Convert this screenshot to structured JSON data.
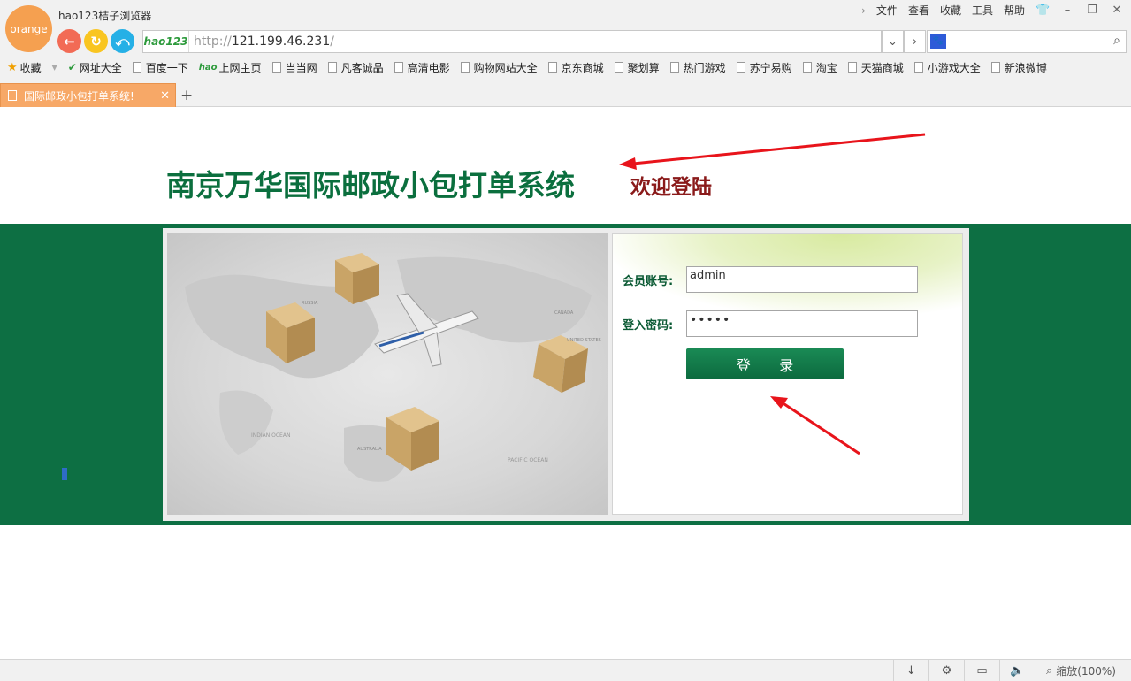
{
  "app": {
    "logo_text": "orange",
    "title": "hao123桔子浏览器",
    "menu": [
      "文件",
      "查看",
      "收藏",
      "工具",
      "帮助"
    ],
    "window_buttons": [
      "shirt-icon",
      "minimize-icon",
      "restore-icon",
      "close-icon"
    ]
  },
  "nav": {
    "back_icon": "←",
    "refresh_icon": "↻",
    "home_icon": "⤺"
  },
  "address_bar": {
    "site_logo": "hao123",
    "url_prefix": "http://",
    "url_host": "121.199.46.231",
    "url_suffix": "/",
    "dropdown_icon": "chevron-down-icon",
    "go_icon": "chevron-right-icon"
  },
  "search": {
    "engine_icon": "paw-icon",
    "search_icon": "search-icon"
  },
  "bookmarks": {
    "favorites_label": "收藏",
    "items": [
      "网址大全",
      "百度一下",
      "上网主页",
      "当当网",
      "凡客诚品",
      "高清电影",
      "购物网站大全",
      "京东商城",
      "聚划算",
      "热门游戏",
      "苏宁易购",
      "淘宝",
      "天猫商城",
      "小游戏大全",
      "新浪微博"
    ]
  },
  "tabs": {
    "active_label": "国际邮政小包打单系统!",
    "new_tab": "+"
  },
  "page": {
    "title": "南京万华国际邮政小包打单系统",
    "welcome": "欢迎登陆",
    "form": {
      "account_label": "会员账号:",
      "account_value": "admin",
      "password_label": "登入密码:",
      "password_value": "•••••",
      "login_button": "登 录"
    },
    "map_labels": [
      "RUSSIA",
      "CANADA",
      "UNITED STATES",
      "AUSTRALIA",
      "INDIAN OCEAN",
      "PACIFIC OCEAN"
    ]
  },
  "status_bar": {
    "download_icon": "download-icon",
    "settings_icon": "gear-icon",
    "screen_icon": "screen-icon",
    "sound_icon": "speaker-icon",
    "zoom_label": "缩放(100%)"
  },
  "colors": {
    "brand_green": "#0d6f43",
    "title_green": "#0b6f3e",
    "welcome_red": "#8a1a1a",
    "tab_orange": "#f7a867",
    "annotation_red": "#e8141b"
  }
}
